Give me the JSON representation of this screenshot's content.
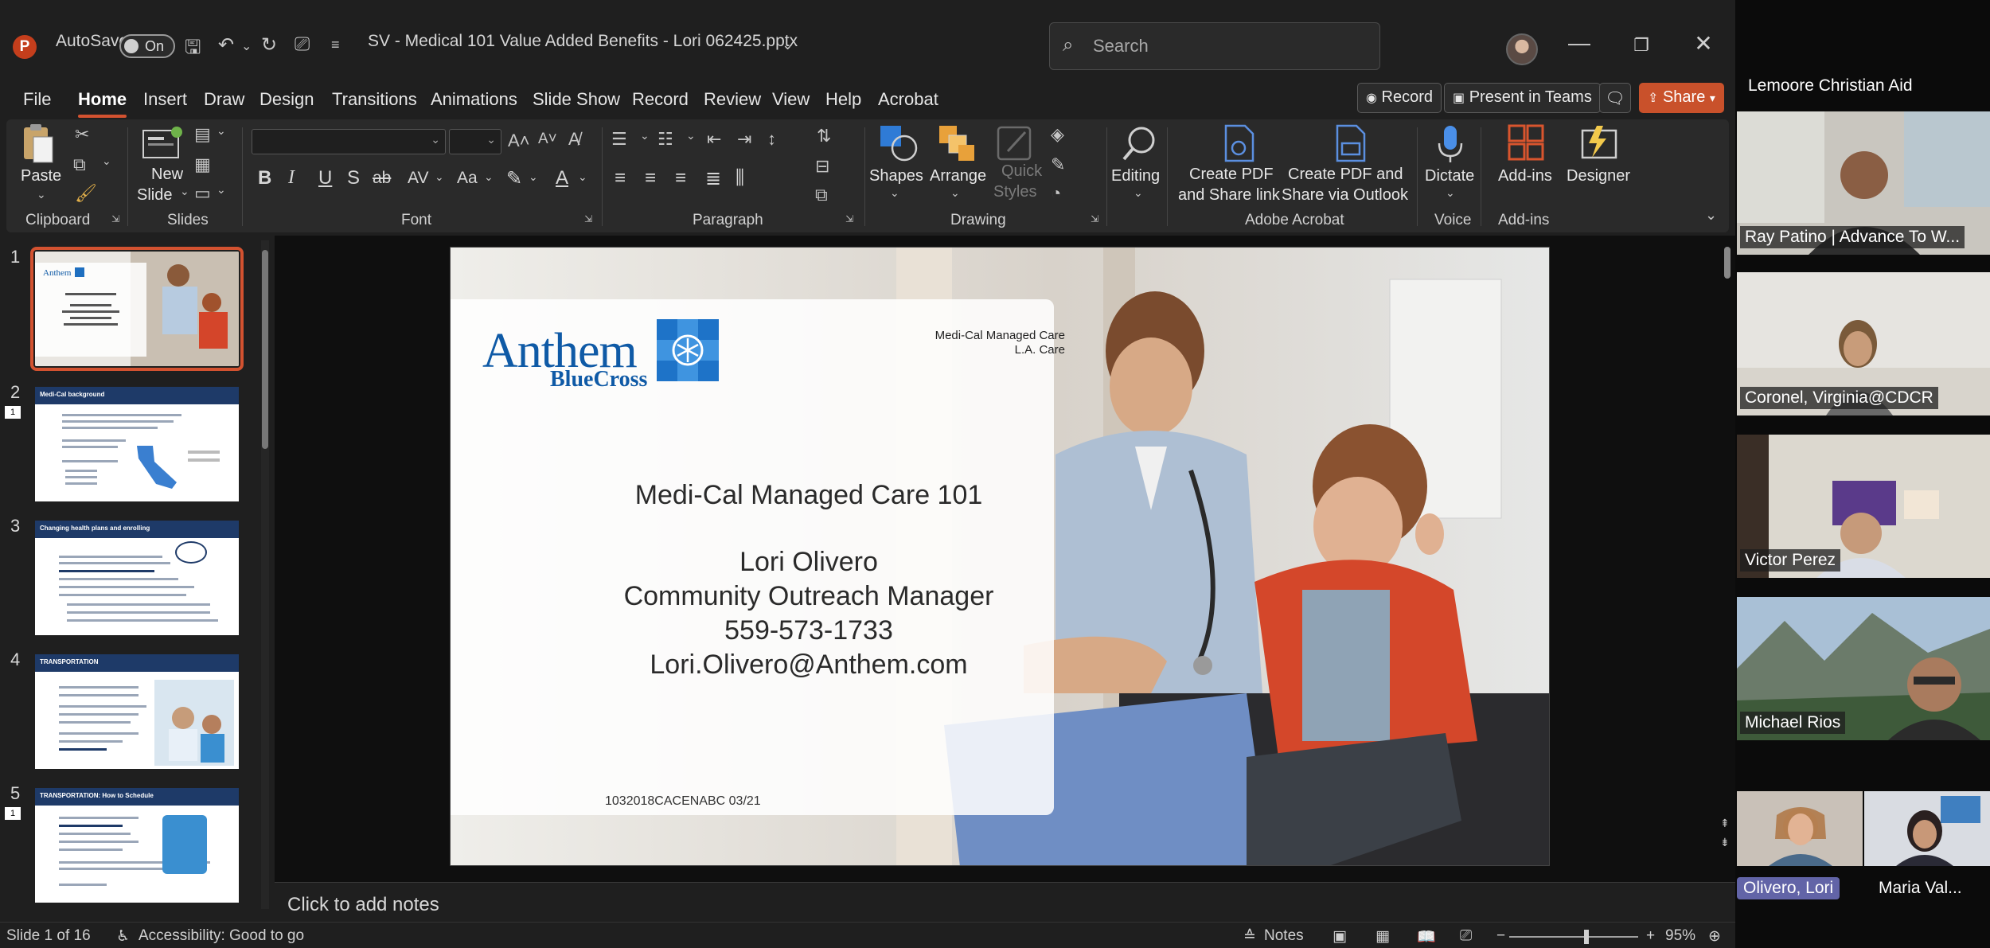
{
  "window": {
    "autosave_label": "AutoSave",
    "autosave_state": "On",
    "file_title": "SV - Medical 101 Value Added Benefits - Lori 062425.pptx",
    "search_placeholder": "Search"
  },
  "menu": {
    "tabs": [
      "File",
      "Home",
      "Insert",
      "Draw",
      "Design",
      "Transitions",
      "Animations",
      "Slide Show",
      "Record",
      "Review",
      "View",
      "Help",
      "Acrobat"
    ],
    "active": "Home",
    "record_btn": "Record",
    "present_btn": "Present in Teams",
    "share_btn": "Share"
  },
  "ribbon": {
    "paste": "Paste",
    "new_slide_1": "New",
    "new_slide_2": "Slide",
    "shapes": "Shapes",
    "arrange": "Arrange",
    "quick_styles_1": "Quick",
    "quick_styles_2": "Styles",
    "editing": "Editing",
    "create_pdf_link_1": "Create PDF",
    "create_pdf_link_2": "and Share link",
    "create_pdf_outlook_1": "Create PDF and",
    "create_pdf_outlook_2": "Share via Outlook",
    "dictate": "Dictate",
    "addins": "Add-ins",
    "designer": "Designer",
    "groups": {
      "clipboard": "Clipboard",
      "slides": "Slides",
      "font": "Font",
      "paragraph": "Paragraph",
      "drawing": "Drawing",
      "adobe": "Adobe Acrobat",
      "voice": "Voice",
      "addins": "Add-ins"
    }
  },
  "thumbnails": [
    {
      "num": "1",
      "selected": true,
      "title": ""
    },
    {
      "num": "2",
      "selected": false,
      "title": "Medi-Cal background"
    },
    {
      "num": "3",
      "selected": false,
      "title": "Changing health plans and enrolling"
    },
    {
      "num": "4",
      "selected": false,
      "title": "TRANSPORTATION"
    },
    {
      "num": "5",
      "selected": false,
      "title": "TRANSPORTATION: How to Schedule"
    }
  ],
  "slide": {
    "brand": "Anthem",
    "brand_sub": "BlueCross",
    "top_right_1": "Medi-Cal Managed Care",
    "top_right_2": "L.A. Care",
    "title": "Medi-Cal Managed Care 101",
    "presenter": "Lori Olivero",
    "role": "Community Outreach Manager",
    "phone": "559-573-1733",
    "email": "Lori.Olivero@Anthem.com",
    "code": "1032018CACENABC 03/21"
  },
  "notes_placeholder": "Click to add notes",
  "status": {
    "slide_info": "Slide 1 of 16",
    "accessibility": "Accessibility: Good to go",
    "notes": "Notes",
    "zoom": "95%",
    "zoom_fraction": 0.6
  },
  "teams": {
    "title": "Lemoore Christian Aid",
    "participants": [
      "Ray Patino | Advance To W...",
      "Coronel, Virginia@CDCR",
      "Victor Perez",
      "Michael Rios"
    ],
    "bottom": [
      "Olivero, Lori",
      "Maria Val..."
    ]
  }
}
